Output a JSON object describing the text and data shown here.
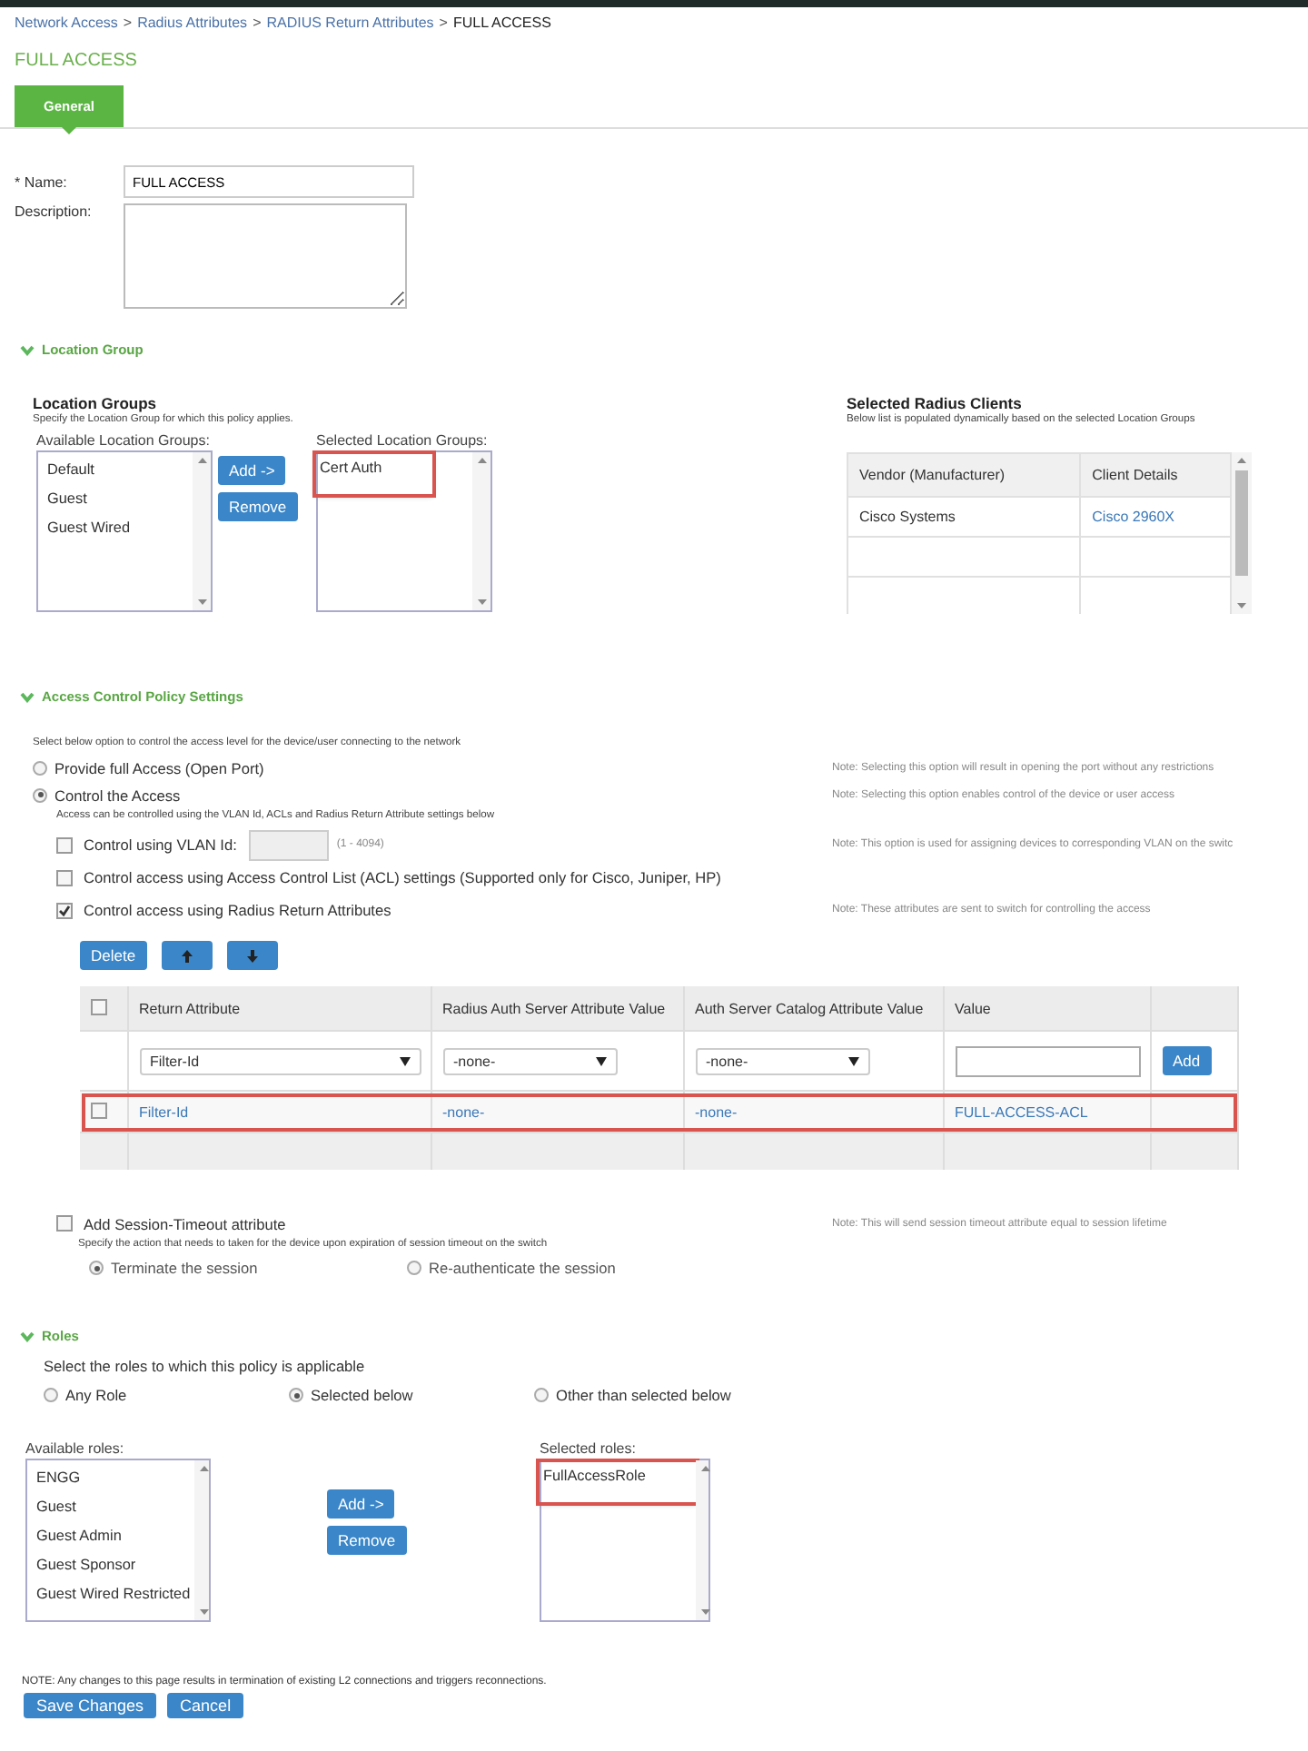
{
  "breadcrumb": [
    {
      "label": "Network Access",
      "link": true,
      "separator": ">"
    },
    {
      "label": "Radius Attributes",
      "link": true,
      "separator": ">"
    },
    {
      "label": "RADIUS Return Attributes",
      "link": true,
      "separator": ">"
    },
    {
      "label": "FULL ACCESS",
      "link": false
    }
  ],
  "title": "FULL ACCESS",
  "tabs": [
    {
      "label": "General",
      "selected": true
    }
  ],
  "form": {
    "name_label": "* Name:",
    "name_value": "FULL ACCESS",
    "description_label": "Description:"
  },
  "location_section": {
    "header": "Location Group",
    "expanded": true,
    "title": "Location Groups",
    "hint": "Specify the Location Group for which this policy applies.",
    "available_label": "Available Location Groups:",
    "available": [
      {
        "label": "Default",
        "highlighted": false
      },
      {
        "label": "Guest",
        "highlighted": false
      },
      {
        "label": "Guest Wired",
        "highlighted": false
      }
    ],
    "add_button": "Add ->",
    "remove_button": "Remove",
    "selected_label": "Selected Location Groups:",
    "selected": [
      {
        "label": "Cert Auth",
        "highlighted": true
      }
    ]
  },
  "radius_clients": {
    "title": "Selected Radius Clients",
    "hint": "Below list is populated dynamically based on the selected Location Groups",
    "columns": [
      "Vendor (Manufacturer)",
      "Client Details"
    ],
    "rows": [
      {
        "vendor": "Cisco Systems",
        "client": "Cisco 2960X"
      }
    ]
  },
  "access_section": {
    "header": "Access Control Policy Settings",
    "expanded": true,
    "intro": "Select below option to control the access level for the device/user connecting to the network",
    "options": [
      {
        "label": "Provide full Access (Open Port)",
        "selected": false,
        "note": "Note: Selecting this option will result in opening the port without any restrictions"
      },
      {
        "label": "Control the Access",
        "selected": true,
        "note": "Note: Selecting this option enables control of the device or user access",
        "hint": "Access can be controlled using the VLAN Id, ACLs and Radius Return Attribute settings below"
      }
    ],
    "controls": [
      {
        "kind": "vlan",
        "label": "Control using VLAN Id:",
        "checked": false,
        "range": "(1 - 4094)",
        "note": "Note: This option is used for assigning devices to corresponding VLAN on the switc"
      },
      {
        "kind": "checkbox",
        "label": "Control access using Access Control List (ACL) settings (Supported only for Cisco, Juniper, HP)",
        "checked": false
      },
      {
        "kind": "checkbox",
        "label": "Control access using Radius Return Attributes",
        "checked": true,
        "note": "Note: These attributes are sent to switch for controlling the access"
      }
    ],
    "delete_button": "Delete"
  },
  "attributes_table": {
    "all_checked": false,
    "columns": [
      "Return Attribute",
      "Radius Auth Server Attribute Value",
      "Auth Server Catalog Attribute Value",
      "Value"
    ],
    "new_row": {
      "return_attribute": "Filter-Id",
      "radius_value": "-none-",
      "catalog_value": "-none-",
      "add_button": "Add"
    },
    "rows": [
      {
        "checked": false,
        "highlighted": true,
        "return_attribute": "Filter-Id",
        "radius_value": "-none-",
        "catalog_value": "-none-",
        "value": "FULL-ACCESS-ACL"
      }
    ]
  },
  "session_timeout": {
    "label": "Add Session-Timeout attribute",
    "checked": false,
    "note": "Note: This will send session timeout attribute equal to session lifetime",
    "hint": "Specify the action that needs to taken for the device upon expiration of session timeout on the switch",
    "actions": [
      {
        "label": "Terminate the session",
        "selected": true
      },
      {
        "label": "Re-authenticate the session",
        "selected": false
      }
    ]
  },
  "roles_section": {
    "header": "Roles",
    "expanded": true,
    "intro": "Select the roles to which this policy is applicable",
    "options": [
      {
        "label": "Any Role",
        "selected": false
      },
      {
        "label": "Selected below",
        "selected": true
      },
      {
        "label": "Other than selected below",
        "selected": false
      }
    ],
    "available_label": "Available roles:",
    "available": [
      {
        "label": "ENGG",
        "highlighted": false
      },
      {
        "label": "Guest",
        "highlighted": false
      },
      {
        "label": "Guest Admin",
        "highlighted": false
      },
      {
        "label": "Guest Sponsor",
        "highlighted": false
      },
      {
        "label": "Guest Wired Restricted",
        "highlighted": false
      }
    ],
    "add_button": "Add ->",
    "remove_button": "Remove",
    "selected_label": "Selected roles:",
    "selected": [
      {
        "label": "FullAccessRole",
        "highlighted": true
      }
    ]
  },
  "footer": {
    "note": "NOTE: Any changes to this page results in termination of existing L2 connections and triggers reconnections.",
    "save_button": "Save Changes",
    "cancel_button": "Cancel"
  }
}
